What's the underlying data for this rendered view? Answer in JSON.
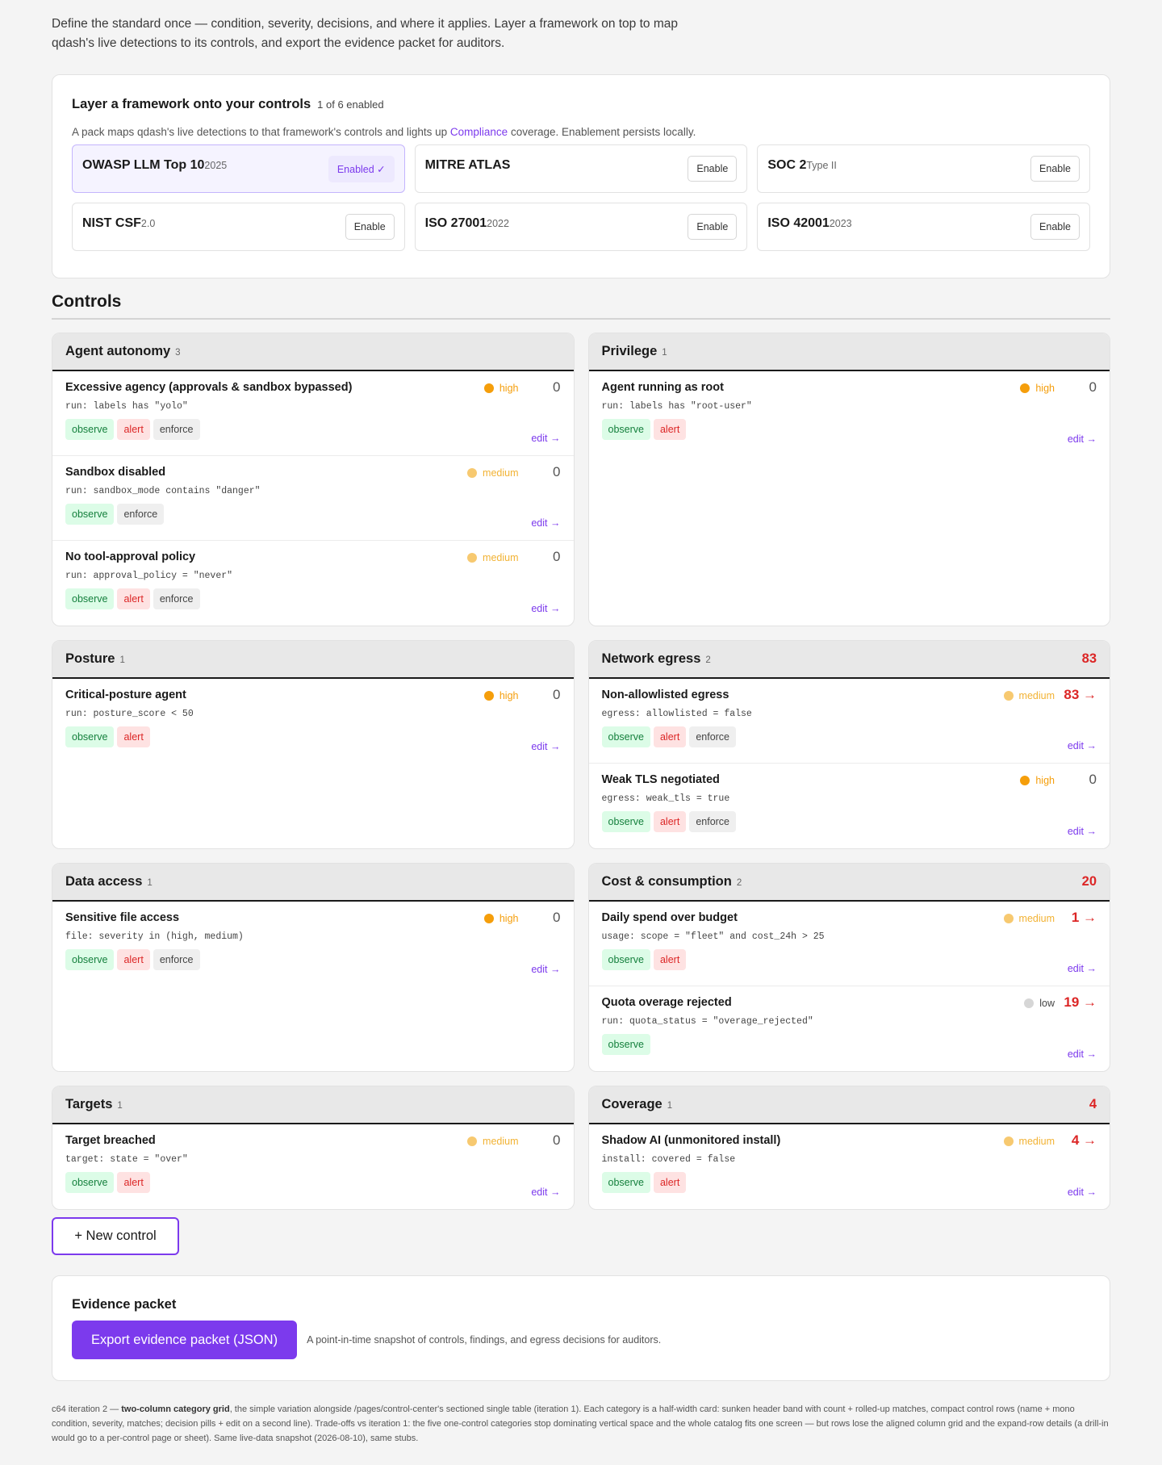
{
  "intro": "Define the standard once — condition, severity, decisions, and where it applies. Layer a framework on top to map qdash's live detections to its controls, and export the evidence packet for auditors.",
  "frameworks": {
    "title": "Layer a framework onto your controls",
    "count": "1 of 6 enabled",
    "desc_before": "A pack maps qdash's live detections to that framework's controls and lights up ",
    "desc_link": "Compliance",
    "desc_after": " coverage. Enablement persists locally.",
    "items": [
      {
        "name": "OWASP LLM Top 10",
        "ver": "2025",
        "button": "Enabled ✓",
        "enabled": true
      },
      {
        "name": "MITRE ATLAS",
        "ver": "",
        "button": "Enable",
        "enabled": false
      },
      {
        "name": "SOC 2",
        "ver": "Type II",
        "button": "Enable",
        "enabled": false
      },
      {
        "name": "NIST CSF",
        "ver": "2.0",
        "button": "Enable",
        "enabled": false
      },
      {
        "name": "ISO 27001",
        "ver": "2022",
        "button": "Enable",
        "enabled": false
      },
      {
        "name": "ISO 42001",
        "ver": "2023",
        "button": "Enable",
        "enabled": false
      }
    ]
  },
  "controls": {
    "title": "Controls",
    "edit_label": "edit →",
    "categories": [
      {
        "name": "Agent autonomy",
        "count": "3",
        "total": "",
        "rows": [
          {
            "name": "Excessive agency (approvals & sandbox bypassed)",
            "cond": "run: labels has \"yolo\"",
            "severity": "high",
            "matches": "0",
            "pills": [
              "observe",
              "alert",
              "enforce"
            ]
          },
          {
            "name": "Sandbox disabled",
            "cond": "run: sandbox_mode contains \"danger\"",
            "severity": "medium",
            "matches": "0",
            "pills": [
              "observe",
              "enforce"
            ]
          },
          {
            "name": "No tool-approval policy",
            "cond": "run: approval_policy = \"never\"",
            "severity": "medium",
            "matches": "0",
            "pills": [
              "observe",
              "alert",
              "enforce"
            ]
          }
        ]
      },
      {
        "name": "Privilege",
        "count": "1",
        "total": "",
        "rows": [
          {
            "name": "Agent running as root",
            "cond": "run: labels has \"root-user\"",
            "severity": "high",
            "matches": "0",
            "pills": [
              "observe",
              "alert"
            ]
          }
        ]
      },
      {
        "name": "Posture",
        "count": "1",
        "total": "",
        "rows": [
          {
            "name": "Critical-posture agent",
            "cond": "run: posture_score < 50",
            "severity": "high",
            "matches": "0",
            "pills": [
              "observe",
              "alert"
            ]
          }
        ]
      },
      {
        "name": "Network egress",
        "count": "2",
        "total": "83",
        "rows": [
          {
            "name": "Non-allowlisted egress",
            "cond": "egress: allowlisted = false",
            "severity": "medium",
            "matches": "83 →",
            "hot": true,
            "pills": [
              "observe",
              "alert",
              "enforce"
            ]
          },
          {
            "name": "Weak TLS negotiated",
            "cond": "egress: weak_tls = true",
            "severity": "high",
            "matches": "0",
            "pills": [
              "observe",
              "alert",
              "enforce"
            ]
          }
        ]
      },
      {
        "name": "Data access",
        "count": "1",
        "total": "",
        "rows": [
          {
            "name": "Sensitive file access",
            "cond": "file: severity in (high, medium)",
            "severity": "high",
            "matches": "0",
            "pills": [
              "observe",
              "alert",
              "enforce"
            ]
          }
        ]
      },
      {
        "name": "Cost & consumption",
        "count": "2",
        "total": "20",
        "rows": [
          {
            "name": "Daily spend over budget",
            "cond": "usage: scope = \"fleet\" and cost_24h > 25",
            "severity": "medium",
            "matches": "1 →",
            "hot": true,
            "pills": [
              "observe",
              "alert"
            ]
          },
          {
            "name": "Quota overage rejected",
            "cond": "run: quota_status = \"overage_rejected\"",
            "severity": "low",
            "matches": "19 →",
            "hot": true,
            "pills": [
              "observe"
            ]
          }
        ]
      },
      {
        "name": "Targets",
        "count": "1",
        "total": "",
        "rows": [
          {
            "name": "Target breached",
            "cond": "target: state = \"over\"",
            "severity": "medium",
            "matches": "0",
            "pills": [
              "observe",
              "alert"
            ]
          }
        ]
      },
      {
        "name": "Coverage",
        "count": "1",
        "total": "4",
        "rows": [
          {
            "name": "Shadow AI (unmonitored install)",
            "cond": "install: covered = false",
            "severity": "medium",
            "matches": "4 →",
            "hot": true,
            "pills": [
              "observe",
              "alert"
            ]
          }
        ]
      }
    ],
    "new_button": "+ New control"
  },
  "evidence": {
    "title": "Evidence packet",
    "button": "Export evidence packet (JSON)",
    "desc": "A point-in-time snapshot of controls, findings, and egress decisions for auditors."
  },
  "footnote": {
    "before": "c64 iteration 2 — ",
    "bold": "two-column category grid",
    "after": ", the simple variation alongside /pages/control-center's sectioned single table (iteration 1). Each category is a half-width card: sunken header band with count + rolled-up matches, compact control rows (name + mono condition, severity, matches; decision pills + edit on a second line). Trade-offs vs iteration 1: the five one-control categories stop dominating vertical space and the whole catalog fits one screen — but rows lose the aligned column grid and the expand-row details (a drill-in would go to a per-control page or sheet). Same live-data snapshot (2026-08-10), same stubs."
  }
}
